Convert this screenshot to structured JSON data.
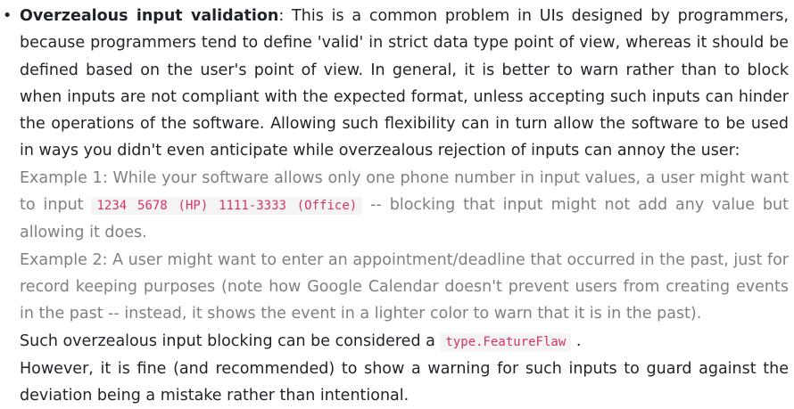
{
  "item": {
    "bullet": "•",
    "term": "Overzealous input validation",
    "intro": ": This is a common problem in UIs designed by programmers, because programmers tend to define 'valid' in strict data type point of view, whereas it should be defined based on the user's point of view. In general, it is better to warn rather than to block when inputs are not compliant with the expected format, unless accepting such inputs can hinder the operations of the software. Allowing such flexibility can in turn allow the software to be used in ways you didn't even anticipate while overzealous rejection of inputs can annoy the user:",
    "example1_before": "Example 1: While your software allows only one phone number in input values, a user might want to input ",
    "example1_code": "1234 5678 (HP) 1111-3333 (Office)",
    "example1_after": " -- blocking that input might not add any value but allowing it does.",
    "example2": "Example 2: A user might want to enter an appointment/deadline that occurred in the past, just for record keeping purposes (note how Google Calendar doesn't prevent users from creating events in the past -- instead, it shows the event in a lighter color to warn that it is in the past).",
    "consider_before": "Such overzealous input blocking can be considered a ",
    "consider_code": "type.FeatureFlaw",
    "consider_after": " .",
    "closing": "However, it is fine (and recommended) to show a warning for such inputs to guard against the deviation being a mistake rather than intentional."
  }
}
